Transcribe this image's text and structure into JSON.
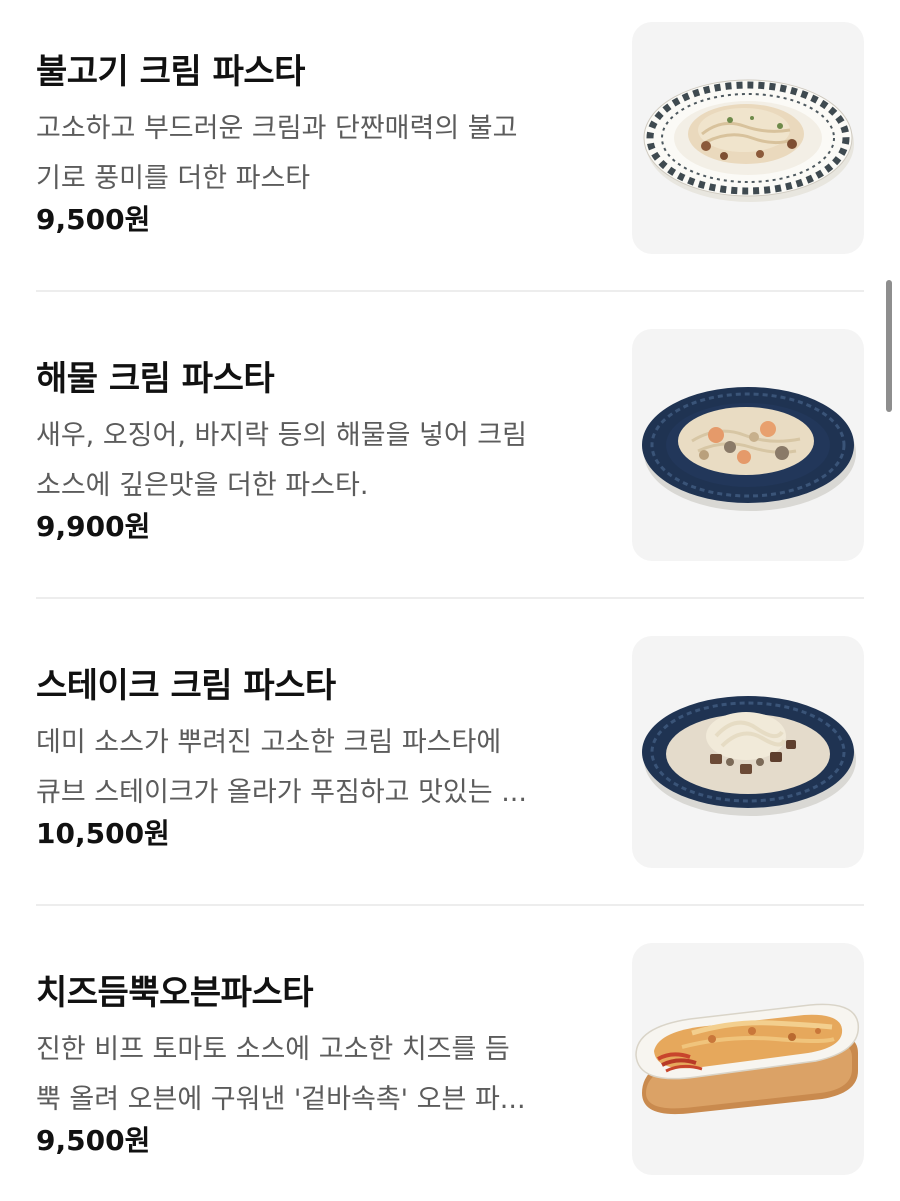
{
  "menu": {
    "items": [
      {
        "name": "불고기 크림 파스타",
        "desc_line1": "고소하고 부드러운 크림과 단짠매력의 불고",
        "desc_line2": "기로 풍미를 더한 파스타",
        "price": "9,500원",
        "image": "bulgogi-cream-pasta-photo"
      },
      {
        "name": "해물 크림 파스타",
        "desc_line1": "새우, 오징어, 바지락 등의 해물을 넣어 크림",
        "desc_line2": "소스에 깊은맛을 더한 파스타.",
        "price": "9,900원",
        "image": "seafood-cream-pasta-photo"
      },
      {
        "name": "스테이크 크림 파스타",
        "desc_line1": "데미 소스가 뿌려진 고소한 크림 파스타에",
        "desc_line2": "큐브 스테이크가 올라가 푸짐하고 맛있는 ...",
        "price": "10,500원",
        "image": "steak-cream-pasta-photo"
      },
      {
        "name": "치즈듬뿍오븐파스타",
        "desc_line1": "진한 비프 토마토 소스에 고소한 치즈를 듬",
        "desc_line2": "뿍 올려 오븐에 구워낸 '겉바속촉' 오븐 파...",
        "price": "9,500원",
        "image": "cheese-oven-pasta-photo"
      }
    ]
  },
  "colors": {
    "text_primary": "#111111",
    "text_secondary": "#5c5c5c",
    "thumb_bg": "#f4f4f4",
    "divider": "#ededed"
  }
}
